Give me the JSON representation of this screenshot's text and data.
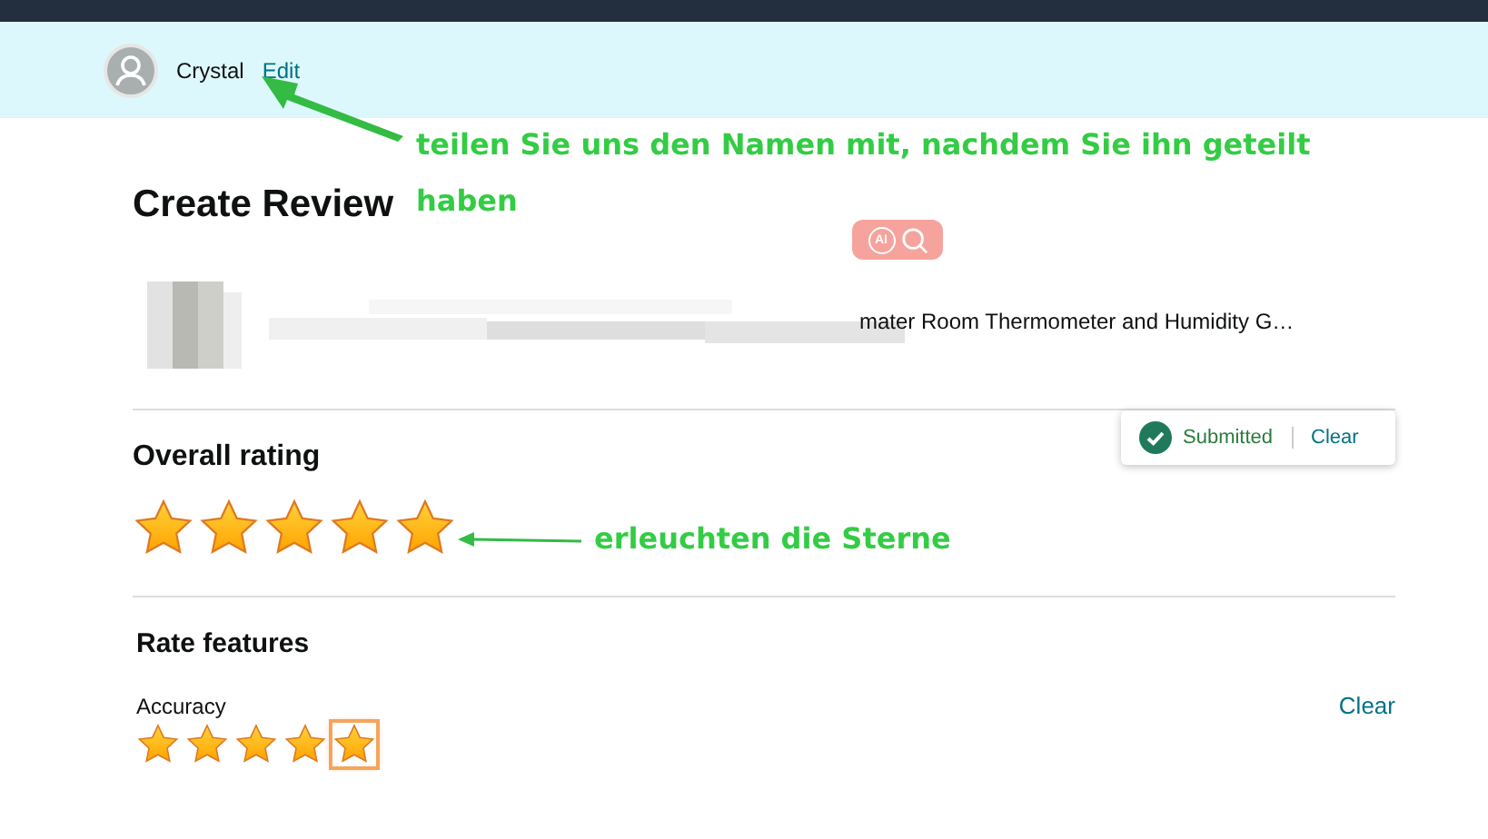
{
  "header": {
    "user_name": "Crystal",
    "edit_link": "Edit"
  },
  "annotations": [
    {
      "text": "teilen Sie uns den Namen mit, nachdem Sie ihn geteilt haben"
    },
    {
      "text": "erleuchten die Sterne"
    }
  ],
  "title": "Create Review",
  "ai_badge": "AI",
  "product": {
    "title": "mater Room Thermometer and Humidity G…"
  },
  "overall_rating": {
    "heading": "Overall rating",
    "stars": 5,
    "status": "Submitted",
    "clear": "Clear"
  },
  "features": {
    "heading": "Rate features",
    "items": [
      {
        "name": "Accuracy",
        "stars": 5,
        "focused": true,
        "clear": "Clear"
      }
    ]
  }
}
